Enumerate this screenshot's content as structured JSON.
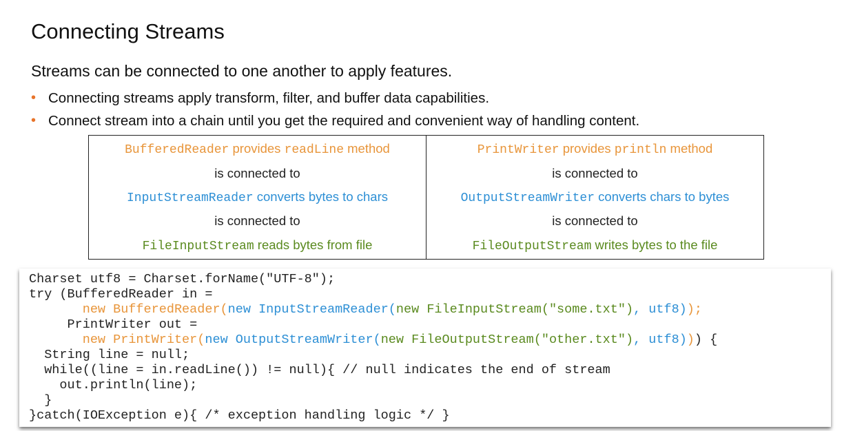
{
  "title": "Connecting Streams",
  "intro": "Streams can be connected to one another to apply features.",
  "bullets": [
    "Connecting streams apply transform, filter, and buffer data capabilities.",
    "Connect stream into a chain until you get the required and convenient way of handling content."
  ],
  "chain": {
    "left": {
      "r1_code": "BufferedReader",
      "r1_a": " provides ",
      "r1_code2": "readLine",
      "r1_b": " method",
      "c1": "is connected to",
      "r2_code": "InputStreamReader",
      "r2_text": " converts bytes to chars",
      "c2": "is connected to",
      "r3_code": "FileInputStream",
      "r3_text": " reads bytes from file"
    },
    "right": {
      "r1_code": "PrintWriter",
      "r1_a": " provides ",
      "r1_code2": "println",
      "r1_b": " method",
      "c1": "is connected to",
      "r2_code": "OutputStreamWriter",
      "r2_text": " converts chars to bytes",
      "c2": "is connected to",
      "r3_code": "FileOutputStream",
      "r3_text": " writes bytes to the file"
    }
  },
  "code": {
    "l1": "Charset utf8 = Charset.forName(\"UTF-8\");",
    "l2": "try (BufferedReader in =",
    "l3_indent": "       ",
    "l3_o1": "new BufferedReader(",
    "l3_b1": "new InputStreamReader(",
    "l3_g": "new FileInputStream(\"some.txt\")",
    "l3_b2": ", utf8)",
    "l3_o2": ");",
    "l4": "     PrintWriter out =",
    "l5_indent": "       ",
    "l5_o1": "new PrintWriter(",
    "l5_b1": "new OutputStreamWriter(",
    "l5_g": "new FileOutputStream(\"other.txt\")",
    "l5_b2": ", utf8)",
    "l5_o2": ")",
    "l5_end": ") {",
    "l6": "  String line = null;",
    "l7": "  while((line = in.readLine()) != null){ // null indicates the end of stream",
    "l8": "    out.println(line);",
    "l9": "  }",
    "l10": "}catch(IOException e){ /* exception handling logic */ }"
  },
  "colors": {
    "bullet": "#e8742a",
    "orange": "#e8953a",
    "blue": "#2d8fd5",
    "green": "#5a8a1f"
  }
}
